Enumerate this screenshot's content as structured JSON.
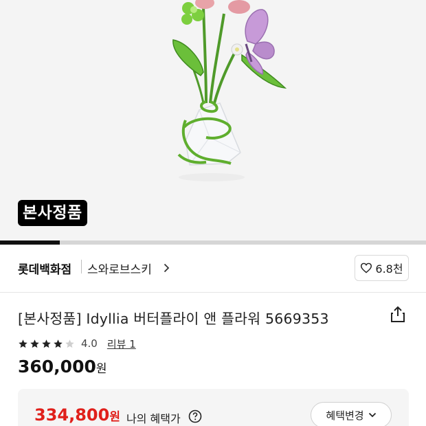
{
  "hero": {
    "badge": "본사정품",
    "gallery_progress": 0.14
  },
  "brand_row": {
    "store": "롯데백화점",
    "brand": "스와로브스키",
    "like_count": "6.8천"
  },
  "product": {
    "title": "[본사정품] Idyllia 버터플라이 앤 플라워 5669353",
    "rating": "4.0",
    "rating_stars": 4,
    "review_link": "리뷰 1",
    "price": "360,000",
    "currency": "원"
  },
  "benefit": {
    "sale_price": "334,800",
    "currency": "원",
    "label": "나의 혜택가",
    "change_button": "혜택변경"
  },
  "icons": {
    "brand_chevron": "chevron-right-icon",
    "like": "heart-icon",
    "share": "share-icon",
    "help": "question-circle-icon",
    "change_chevron": "chevron-down-icon"
  },
  "colors": {
    "sale_red": "#e0201b",
    "badge_bg": "#000000"
  }
}
